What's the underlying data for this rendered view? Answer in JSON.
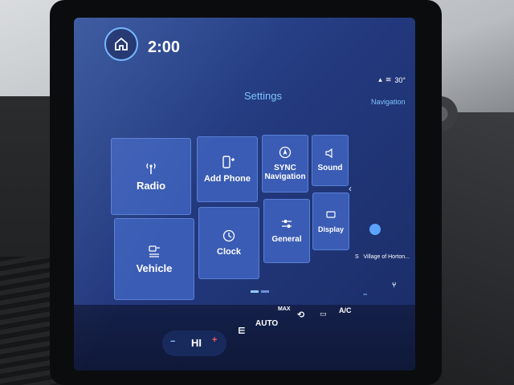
{
  "header": {
    "time": "2:00",
    "temperature": "30°",
    "title": "Settings",
    "nav_shortcut": "Navigation"
  },
  "tiles": [
    {
      "label": "Radio",
      "icon": "radio-antenna-icon"
    },
    {
      "label": "Add Phone",
      "icon": "phone-add-icon"
    },
    {
      "label": "SYNC Navigation",
      "icon": "navigation-compass-icon"
    },
    {
      "label": "Sound",
      "icon": "speaker-icon"
    },
    {
      "label": "Vehicle",
      "icon": "vehicle-settings-icon"
    },
    {
      "label": "Clock",
      "icon": "clock-icon"
    },
    {
      "label": "General",
      "icon": "sliders-icon"
    },
    {
      "label": "Display",
      "icon": "display-icon"
    }
  ],
  "nav_panel": {
    "direction": "S",
    "road": "Village of Horton..."
  },
  "climate": {
    "minus": "−",
    "fan": "HI",
    "plus": "+",
    "auto": "AUTO",
    "max": "MAX",
    "ac": "A/C"
  },
  "colors": {
    "screen_bg": "#23397d",
    "tile_bg": "#3a5cb4",
    "accent": "#7fc3ff"
  }
}
